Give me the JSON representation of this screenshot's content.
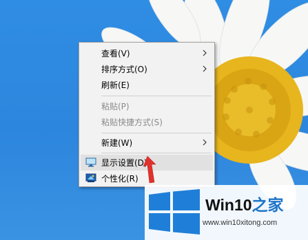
{
  "context_menu": {
    "items": [
      {
        "label": "查看(V)",
        "has_submenu": true,
        "enabled": true
      },
      {
        "label": "排序方式(O)",
        "has_submenu": true,
        "enabled": true
      },
      {
        "label": "刷新(E)",
        "has_submenu": false,
        "enabled": true
      },
      {
        "label": "粘贴(P)",
        "has_submenu": false,
        "enabled": false
      },
      {
        "label": "粘贴快捷方式(S)",
        "has_submenu": false,
        "enabled": false
      },
      {
        "label": "新建(W)",
        "has_submenu": true,
        "enabled": true
      },
      {
        "label": "显示设置(D)",
        "has_submenu": false,
        "enabled": true,
        "highlighted": true,
        "icon": "monitor-icon"
      },
      {
        "label": "个性化(R)",
        "has_submenu": false,
        "enabled": true,
        "icon": "personalize-icon"
      }
    ]
  },
  "watermark": {
    "title_main": "Win10",
    "title_brand": "之家",
    "url": "www.win10xitong.com"
  },
  "colors": {
    "desktop_blue": "#2f8de3",
    "menu_bg": "#f2f2f2",
    "menu_hover": "#e1e1e1",
    "disabled_text": "#8a8a8a",
    "arrow_red": "#e0312b",
    "win_logo_blue": "#1f7fd8",
    "flower_center": "#e7b51d"
  }
}
